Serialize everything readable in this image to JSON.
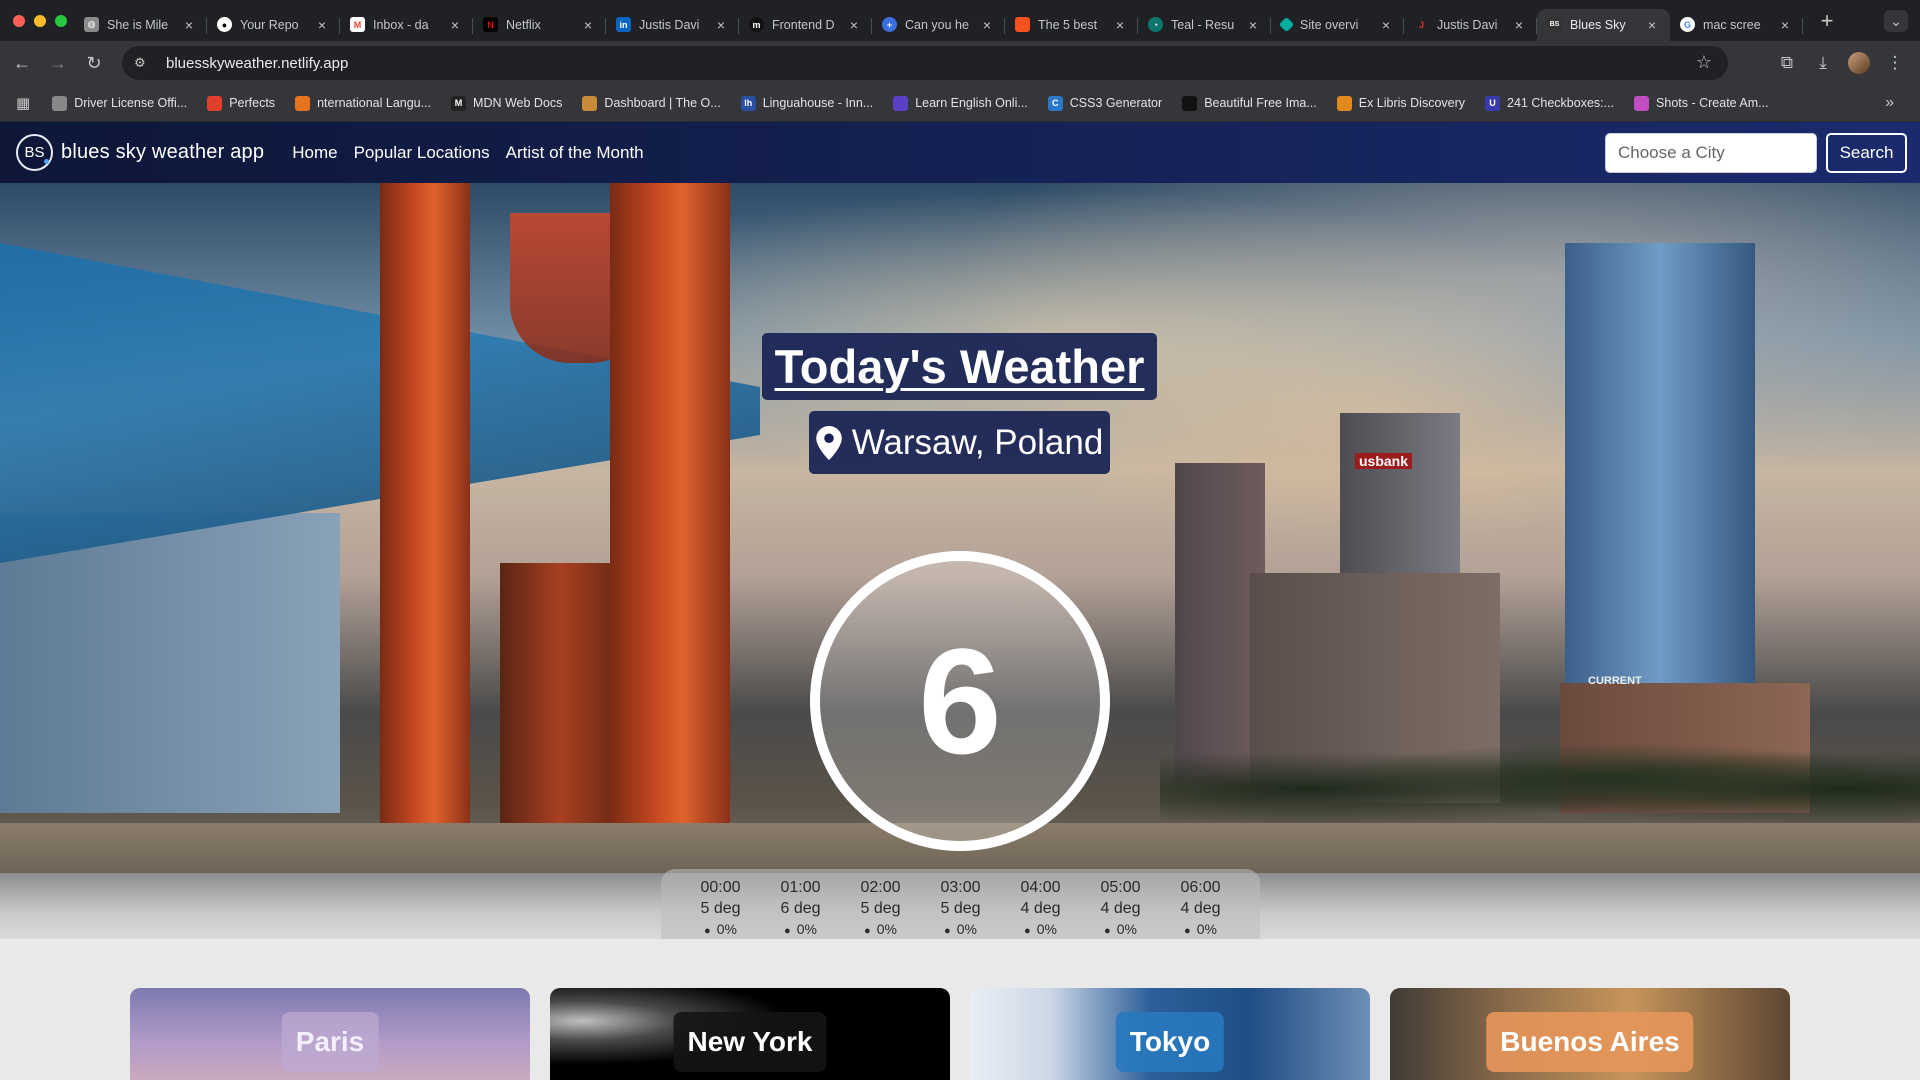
{
  "browser": {
    "tabs": [
      {
        "title": "She is Mile",
        "icon": "globe-icon",
        "color": "#8a8a8a"
      },
      {
        "title": "Your Repo",
        "icon": "github-icon",
        "color": "#ffffff"
      },
      {
        "title": "Inbox - da",
        "icon": "gmail-icon",
        "color": "#ea4335"
      },
      {
        "title": "Netflix",
        "icon": "netflix-icon",
        "color": "#e50914"
      },
      {
        "title": "Justis Davi",
        "icon": "linkedin-icon",
        "color": "#0a66c2"
      },
      {
        "title": "Frontend D",
        "icon": "medium-icon",
        "color": "#111111"
      },
      {
        "title": "Can you he",
        "icon": "plus-cross-icon",
        "color": "#3b6fe0"
      },
      {
        "title": "The 5 best",
        "icon": "square-orange-icon",
        "color": "#f4511e"
      },
      {
        "title": "Teal - Resu",
        "icon": "teal-icon",
        "color": "#0f766e"
      },
      {
        "title": "Site overvi",
        "icon": "netlify-icon",
        "color": "#00ad9f"
      },
      {
        "title": "Justis Davi",
        "icon": "j-icon",
        "color": "#d93025"
      },
      {
        "title": "Blues Sky",
        "icon": "bs-icon",
        "color": "#333333",
        "active": true
      },
      {
        "title": "mac scree",
        "icon": "google-icon",
        "color": "#4285f4"
      }
    ],
    "url": "bluesskyweather.netlify.app",
    "bookmarks": [
      {
        "label": "Driver License Offi...",
        "color": "#888888"
      },
      {
        "label": "Perfects",
        "color": "#e0402b"
      },
      {
        "label": "nternational Langu...",
        "color": "#e8731e"
      },
      {
        "label": "MDN Web Docs",
        "color": "#222222"
      },
      {
        "label": "Dashboard | The O...",
        "color": "#c98a3a"
      },
      {
        "label": "Linguahouse - Inn...",
        "color": "#2a4fa0"
      },
      {
        "label": "Learn English Onli...",
        "color": "#5b3fc4"
      },
      {
        "label": "CSS3 Generator",
        "color": "#2a78c8"
      },
      {
        "label": "Beautiful Free Ima...",
        "color": "#111111"
      },
      {
        "label": "Ex Libris Discovery",
        "color": "#e08a1e"
      },
      {
        "label": "241 Checkboxes:...",
        "color": "#3a3ab0"
      },
      {
        "label": "Shots - Create Am...",
        "color": "#c04ec0"
      }
    ]
  },
  "site": {
    "logo_text": "BS",
    "brand": "blues sky weather app",
    "nav": [
      "Home",
      "Popular Locations",
      "Artist of the Month"
    ],
    "search_placeholder": "Choose a City",
    "search_button": "Search"
  },
  "hero": {
    "title": "Today's Weather",
    "location": "Warsaw, Poland",
    "temperature": "6",
    "background_signs": {
      "bank": "usbank",
      "current": "CURRENT"
    }
  },
  "hourly": [
    {
      "time": "00:00",
      "temp": "5 deg",
      "precip": "0%"
    },
    {
      "time": "01:00",
      "temp": "6 deg",
      "precip": "0%"
    },
    {
      "time": "02:00",
      "temp": "5 deg",
      "precip": "0%"
    },
    {
      "time": "03:00",
      "temp": "5 deg",
      "precip": "0%"
    },
    {
      "time": "04:00",
      "temp": "4 deg",
      "precip": "0%"
    },
    {
      "time": "05:00",
      "temp": "4 deg",
      "precip": "0%"
    },
    {
      "time": "06:00",
      "temp": "4 deg",
      "precip": "0%"
    }
  ],
  "cities": [
    "Paris",
    "New York",
    "Tokyo",
    "Buenos Aires"
  ]
}
